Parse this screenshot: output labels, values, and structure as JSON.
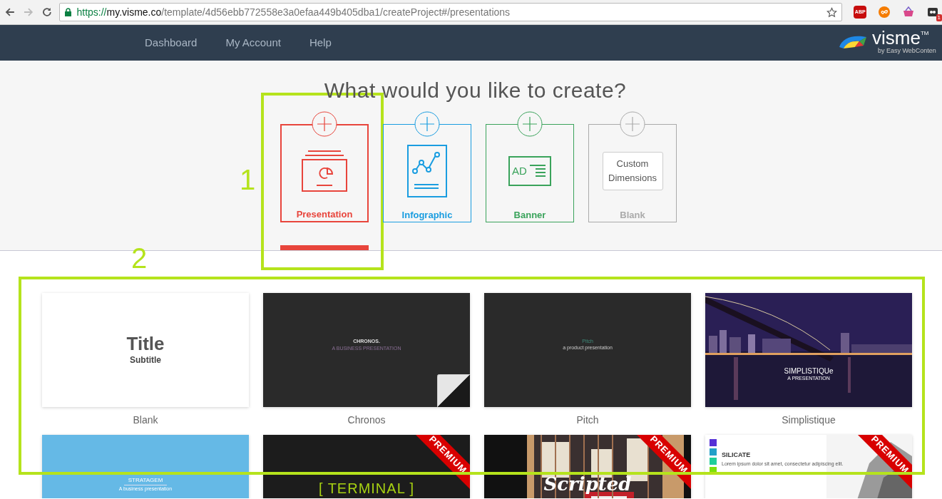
{
  "browser": {
    "url_host": "my.visme.co",
    "url_scheme": "https://",
    "url_path": "/template/4d56ebb772558e3a0efaa449b405dba1/createProject#/presentations",
    "extensions": [
      {
        "kind": "abp",
        "label": "ABP"
      },
      {
        "kind": "infinity"
      },
      {
        "kind": "basket"
      },
      {
        "kind": "badge",
        "label": "1"
      }
    ]
  },
  "nav": {
    "items": [
      "Dashboard",
      "My Account",
      "Help"
    ],
    "logo": {
      "name": "visme",
      "mark": "TM",
      "tagline": "by Easy WebConten"
    }
  },
  "heading": "What would you like to create?",
  "project_types": [
    {
      "kind": "presentation",
      "label": "Presentation",
      "color": "#e8453c",
      "selected": true
    },
    {
      "kind": "infographic",
      "label": "Infographic",
      "color": "#1a9de0",
      "selected": false
    },
    {
      "kind": "banner",
      "label": "Banner",
      "color": "#3aa35b",
      "selected": false,
      "icon_text": "AD"
    },
    {
      "kind": "blank",
      "label": "Blank",
      "color": "#aaaaaa",
      "selected": false,
      "icon_text": "Custom Dimensions"
    }
  ],
  "templates": [
    {
      "name": "Blank",
      "kind": "blank",
      "title": "Title",
      "subtitle": "Subtitle",
      "premium": false,
      "corner_fold": false
    },
    {
      "name": "Chronos",
      "kind": "chronos",
      "title": "CHRONOS.",
      "subtitle": "A BUSINESS PRESENTATION",
      "premium": false,
      "corner_fold": true
    },
    {
      "name": "Pitch",
      "kind": "pitch",
      "title": "Pitch",
      "subtitle": "a product presentation",
      "premium": false,
      "corner_fold": false
    },
    {
      "name": "Simplistique",
      "title": "SIMPLISTIQUe",
      "subtitle": "A PRESENTATION",
      "premium": false,
      "corner_fold": false
    },
    {
      "kind": "stratagem",
      "title": "STRATAGEM",
      "subtitle": "A business presentation",
      "premium": false
    },
    {
      "kind": "terminal",
      "title": "[ TERMINAL ]",
      "premium": true,
      "ribbon": "PREMIUM"
    },
    {
      "kind": "scripted",
      "title": "Scripted",
      "premium": true,
      "ribbon": "PREMIUM"
    },
    {
      "kind": "silicate",
      "title": "SILICATE",
      "subtitle": "Lorem ipsum dolor sit amet, consectetur adipiscing elit.",
      "premium": true,
      "ribbon": "PREMIUM"
    }
  ],
  "annotations": [
    {
      "label": "1"
    },
    {
      "label": "2"
    }
  ]
}
